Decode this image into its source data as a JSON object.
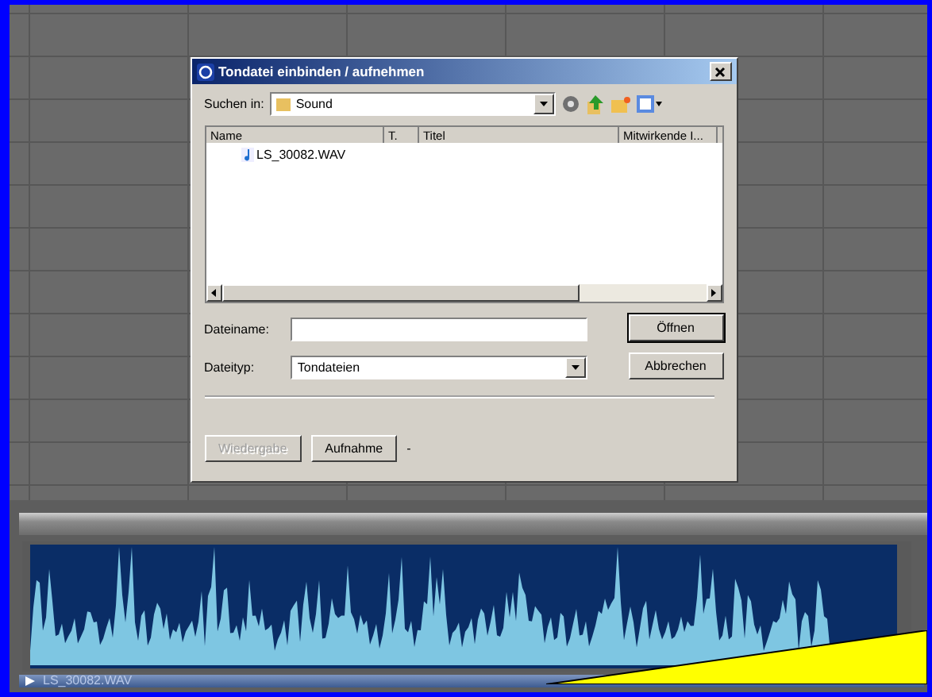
{
  "dialog": {
    "title": "Tondatei einbinden / aufnehmen",
    "look_in_label": "Suchen in:",
    "look_in_value": "Sound",
    "columns": [
      "Name",
      "T.",
      "Titel",
      "Mitwirkende I..."
    ],
    "files": [
      {
        "name": "LS_30082.WAV"
      }
    ],
    "filename_label": "Dateiname:",
    "filetype_label": "Dateityp:",
    "filetype_value": "Tondateien",
    "buttons": [
      {
        "label": "Öffnen",
        "default": true
      },
      {
        "label": "Abbrechen",
        "default": false
      }
    ],
    "bottom_buttons": [
      {
        "label": "Wiedergabe",
        "disabled": true
      },
      {
        "label": "Aufnahme",
        "disabled": false
      }
    ],
    "bottom_note": "-"
  },
  "track": {
    "clip_name": "LS_30082.WAV"
  }
}
